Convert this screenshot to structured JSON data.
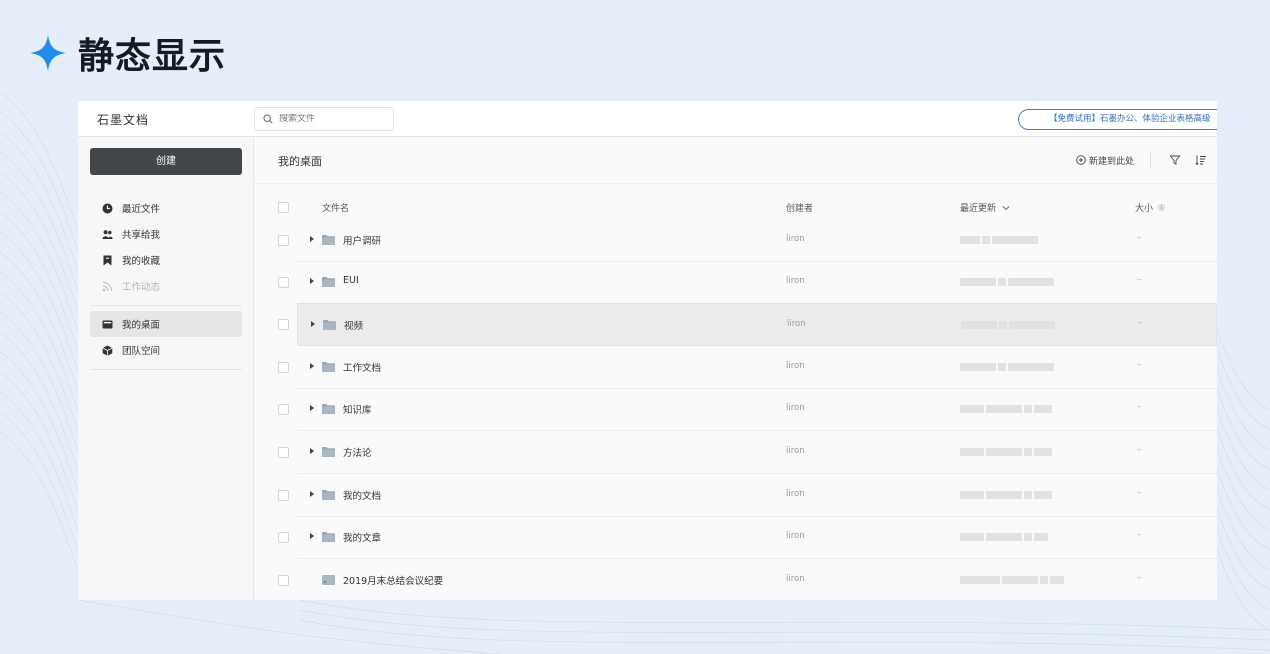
{
  "slide": {
    "title": "静态显示",
    "accent": "#1e8cf0"
  },
  "app": {
    "brand": "石墨文档",
    "search": {
      "placeholder": "搜索文件",
      "value": ""
    },
    "promo": "【免费试用】石墨办公、体验企业表格高级",
    "create_label": "创建",
    "nav": [
      {
        "label": "最近文件",
        "icon": "clock-icon",
        "disabled": false
      },
      {
        "label": "共享给我",
        "icon": "users-icon",
        "disabled": false
      },
      {
        "label": "我的收藏",
        "icon": "bookmark-icon",
        "disabled": false
      },
      {
        "label": "工作动态",
        "icon": "rss-icon",
        "disabled": true
      }
    ],
    "nav2": [
      {
        "label": "我的桌面",
        "icon": "desktop-icon",
        "active": true
      },
      {
        "label": "团队空间",
        "icon": "cube-icon",
        "active": false
      }
    ],
    "page_title": "我的桌面",
    "toolbar": {
      "new_here": "新建到此处",
      "filter_icon": "filter-icon",
      "sort_icon": "sort-icon"
    },
    "columns": {
      "name": "文件名",
      "creator": "创建者",
      "updated": "最近更新",
      "size": "大小"
    },
    "rows": [
      {
        "name": "用户调研",
        "creator": "liron",
        "size": "–",
        "type": "folder"
      },
      {
        "name": "EUI",
        "creator": "liron",
        "size": "–",
        "type": "folder"
      },
      {
        "name": "视频",
        "creator": "liron",
        "size": "–",
        "type": "folder"
      },
      {
        "name": "工作文档",
        "creator": "liron",
        "size": "–",
        "type": "folder"
      },
      {
        "name": "知识库",
        "creator": "liron",
        "size": "–",
        "type": "folder"
      },
      {
        "name": "方法论",
        "creator": "liron",
        "size": "–",
        "type": "folder"
      },
      {
        "name": "我的文档",
        "creator": "liron",
        "size": "–",
        "type": "folder"
      },
      {
        "name": "我的文章",
        "creator": "liron",
        "size": "–",
        "type": "folder"
      },
      {
        "name": "2019月末总结会议纪要",
        "creator": "liron",
        "size": "–",
        "type": "document"
      }
    ]
  }
}
